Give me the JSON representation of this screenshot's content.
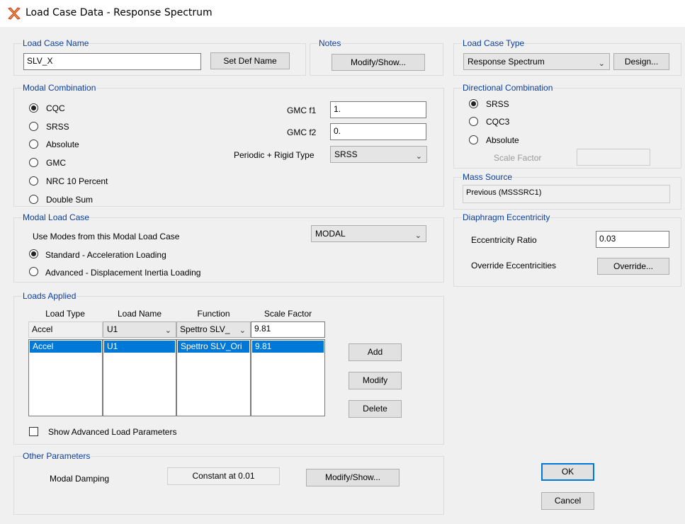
{
  "window": {
    "title": "Load Case Data - Response Spectrum",
    "icon": "app-logo-icon"
  },
  "load_case_name": {
    "label": "Load Case Name",
    "value": "SLV_X",
    "set_def_button": "Set Def Name"
  },
  "notes": {
    "label": "Notes",
    "button": "Modify/Show..."
  },
  "load_case_type": {
    "label": "Load Case Type",
    "selected": "Response Spectrum",
    "design_button": "Design..."
  },
  "modal_combination": {
    "label": "Modal Combination",
    "options": [
      "CQC",
      "SRSS",
      "Absolute",
      "GMC",
      "NRC 10 Percent",
      "Double Sum"
    ],
    "selected": "CQC",
    "gmc_f1_label": "GMC  f1",
    "gmc_f1_value": "1.",
    "gmc_f2_label": "GMC  f2",
    "gmc_f2_value": "0.",
    "periodic_label": "Periodic + Rigid Type",
    "periodic_value": "SRSS"
  },
  "directional_combination": {
    "label": "Directional Combination",
    "options": [
      "SRSS",
      "CQC3",
      "Absolute"
    ],
    "selected": "SRSS",
    "scale_factor_label": "Scale Factor"
  },
  "mass_source": {
    "label": "Mass Source",
    "value": "Previous  (MSSSRC1)"
  },
  "diaphragm": {
    "label": "Diaphragm Eccentricity",
    "ratio_label": "Eccentricity Ratio",
    "ratio_value": "0.03",
    "override_label": "Override Eccentricities",
    "override_button": "Override..."
  },
  "modal_load_case": {
    "label": "Modal Load Case",
    "use_modes_label": "Use Modes from this Modal Load Case",
    "selected": "MODAL",
    "options": [
      "Standard - Acceleration Loading",
      "Advanced - Displacement Inertia Loading"
    ],
    "selected_option": "Standard - Acceleration Loading"
  },
  "loads_applied": {
    "label": "Loads Applied",
    "columns": [
      "Load Type",
      "Load Name",
      "Function",
      "Scale Factor"
    ],
    "edit_row": {
      "load_type": "Accel",
      "load_name": "U1",
      "function": "Spettro SLV_",
      "scale_factor": "9.81"
    },
    "rows": [
      {
        "load_type": "Accel",
        "load_name": "U1",
        "function": "Spettro SLV_Ori",
        "scale_factor": "9.81"
      }
    ],
    "add_button": "Add",
    "modify_button": "Modify",
    "delete_button": "Delete",
    "advanced_checkbox": "Show Advanced Load Parameters"
  },
  "other_parameters": {
    "label": "Other Parameters",
    "modal_damping_label": "Modal Damping",
    "modal_damping_value": "Constant at 0.01",
    "button": "Modify/Show..."
  },
  "footer": {
    "ok": "OK",
    "cancel": "Cancel"
  },
  "colors": {
    "group_label": "#0b3e9c",
    "selection": "#0078d7",
    "default_button_border": "#0078d7"
  }
}
